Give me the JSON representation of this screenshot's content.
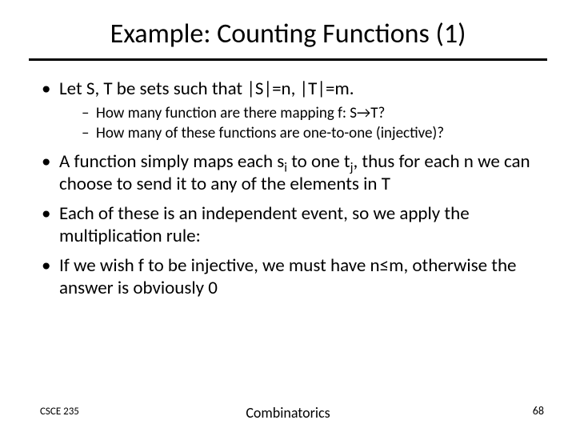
{
  "title": "Example: Counting Functions (1)",
  "bullets": {
    "b1": "Let S, T be sets such that |S|=n, |T|=m.",
    "b1a": "How many function are there mapping f: S→T?",
    "b1b": "How many of these functions are one-to-one (injective)?",
    "b2_pre": "A function simply maps each s",
    "b2_sub1": "i",
    "b2_mid": " to one t",
    "b2_sub2": "j",
    "b2_post": ", thus for each n we can choose to send it to any of the elements in T",
    "b3": "Each of these is an independent event, so we apply the multiplication rule:",
    "b4": "If we wish f to be injective, we must have n≤m, otherwise the answer is obviously 0"
  },
  "footer": {
    "left": "CSCE 235",
    "center": "Combinatorics",
    "right": "68"
  }
}
